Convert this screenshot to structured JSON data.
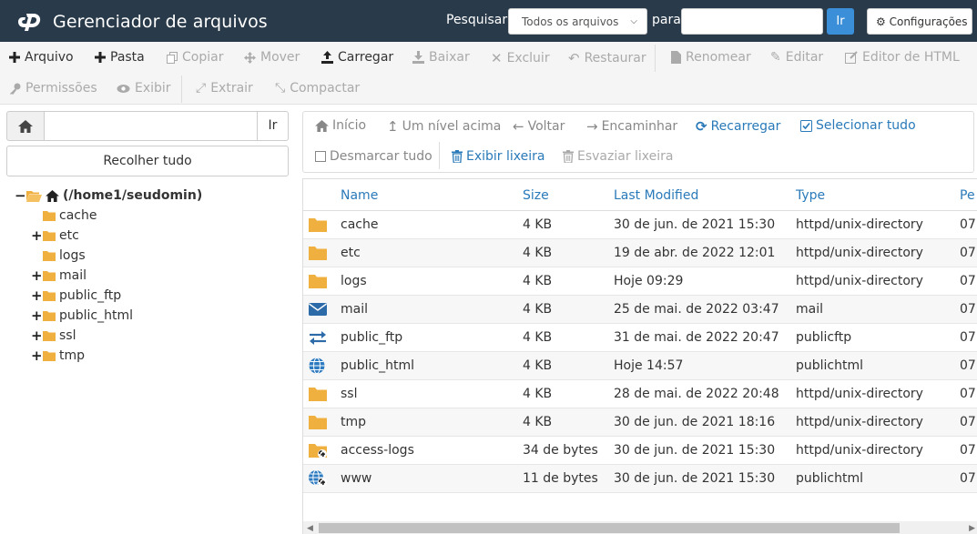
{
  "header": {
    "title": "Gerenciador de arquivos",
    "search_label": "Pesquisar",
    "search_scope": "Todos os arquivos",
    "for_label": "para",
    "search_value": "",
    "go_label": "Ir",
    "settings_label": "Configurações"
  },
  "toolbar": {
    "file": "Arquivo",
    "folder": "Pasta",
    "copy": "Copiar",
    "move": "Mover",
    "upload": "Carregar",
    "download": "Baixar",
    "delete": "Excluir",
    "restore": "Restaurar",
    "rename": "Renomear",
    "edit": "Editar",
    "html_editor": "Editor de HTML",
    "permissions": "Permissões",
    "view": "Exibir",
    "extract": "Extrair",
    "compress": "Compactar"
  },
  "left": {
    "path_value": "",
    "go_label": "Ir",
    "collapse_label": "Recolher tudo",
    "tree_root": "(/home1/seudomin)",
    "tree": [
      {
        "label": "cache",
        "expandable": false
      },
      {
        "label": "etc",
        "expandable": true
      },
      {
        "label": "logs",
        "expandable": false
      },
      {
        "label": "mail",
        "expandable": true
      },
      {
        "label": "public_ftp",
        "expandable": true
      },
      {
        "label": "public_html",
        "expandable": true
      },
      {
        "label": "ssl",
        "expandable": true
      },
      {
        "label": "tmp",
        "expandable": true
      }
    ]
  },
  "nav": {
    "home": "Início",
    "up": "Um nível acima",
    "back": "Voltar",
    "forward": "Encaminhar",
    "reload": "Recarregar",
    "select_all": "Selecionar tudo",
    "deselect_all": "Desmarcar tudo",
    "view_trash": "Exibir lixeira",
    "empty_trash": "Esvaziar lixeira"
  },
  "table": {
    "columns": [
      "Name",
      "Size",
      "Last Modified",
      "Type",
      "Pe"
    ],
    "rows": [
      {
        "icon": "folder-icon",
        "name": "cache",
        "size": "4 KB",
        "modified": "30 de jun. de 2021 15:30",
        "type": "httpd/unix-directory",
        "perm": "07"
      },
      {
        "icon": "folder-icon",
        "name": "etc",
        "size": "4 KB",
        "modified": "19 de abr. de 2022 12:01",
        "type": "httpd/unix-directory",
        "perm": "07"
      },
      {
        "icon": "folder-icon",
        "name": "logs",
        "size": "4 KB",
        "modified": "Hoje 09:29",
        "type": "httpd/unix-directory",
        "perm": "07"
      },
      {
        "icon": "envelope-icon",
        "name": "mail",
        "size": "4 KB",
        "modified": "25 de mai. de 2022 03:47",
        "type": "mail",
        "perm": "07"
      },
      {
        "icon": "exchange-icon",
        "name": "public_ftp",
        "size": "4 KB",
        "modified": "31 de mai. de 2022 20:47",
        "type": "publicftp",
        "perm": "07"
      },
      {
        "icon": "globe-icon",
        "name": "public_html",
        "size": "4 KB",
        "modified": "Hoje 14:57",
        "type": "publichtml",
        "perm": "07"
      },
      {
        "icon": "folder-icon",
        "name": "ssl",
        "size": "4 KB",
        "modified": "28 de mai. de 2022 20:48",
        "type": "httpd/unix-directory",
        "perm": "07"
      },
      {
        "icon": "folder-icon",
        "name": "tmp",
        "size": "4 KB",
        "modified": "30 de jun. de 2021 18:16",
        "type": "httpd/unix-directory",
        "perm": "07"
      },
      {
        "icon": "folder-link-icon",
        "name": "access-logs",
        "size": "34 de bytes",
        "modified": "30 de jun. de 2021 15:30",
        "type": "httpd/unix-directory",
        "perm": "07"
      },
      {
        "icon": "globe-link-icon",
        "name": "www",
        "size": "11 de bytes",
        "modified": "30 de jun. de 2021 15:30",
        "type": "publichtml",
        "perm": "07"
      }
    ]
  },
  "colors": {
    "header_bg": "#293a4a",
    "accent_blue": "#2a7ab9",
    "go_button": "#3b8fd8",
    "folder": "#f0b03f",
    "mail_icon": "#2c6aa8"
  }
}
